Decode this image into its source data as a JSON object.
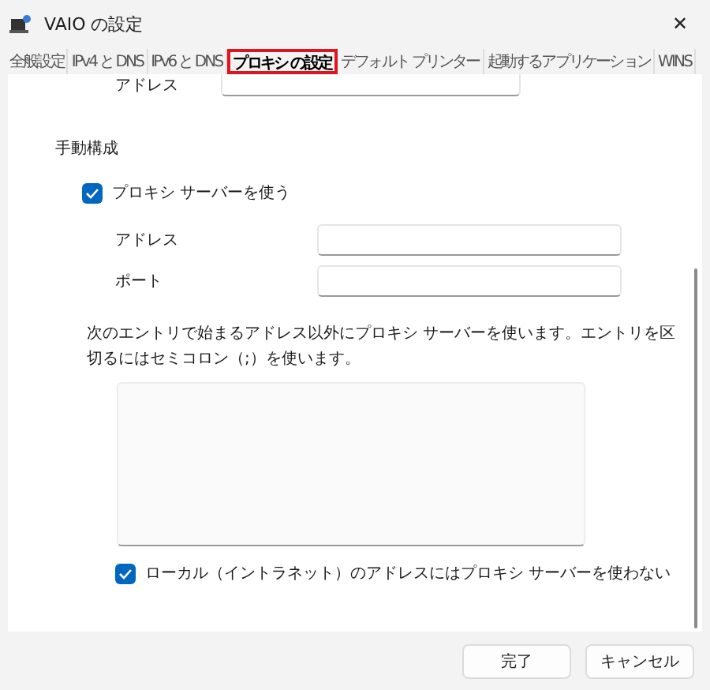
{
  "window": {
    "title": "VAIO の設定",
    "close": "✕"
  },
  "tabs": [
    {
      "label": "全般設定",
      "selected": false
    },
    {
      "label": "IPv4 と DNS",
      "selected": false
    },
    {
      "label": "IPv6 と DNS",
      "selected": false
    },
    {
      "label": "プロキシ の設定",
      "selected": true
    },
    {
      "label": "デフォルト プリンター",
      "selected": false
    },
    {
      "label": "起動するアプリケーション",
      "selected": false
    },
    {
      "label": "WINS",
      "selected": false
    }
  ],
  "auto_address": {
    "label": "アドレス"
  },
  "manual": {
    "heading": "手動構成",
    "use_proxy": {
      "label": "プロキシ サーバーを使う",
      "checked": true
    },
    "fields": [
      {
        "label": "アドレス"
      },
      {
        "label": "ポート"
      }
    ],
    "exceptions_note": "次のエントリで始まるアドレス以外にプロキシ サーバーを使います。エントリを区切るにはセミコロン（;）を使います。",
    "bypass_local": {
      "label": "ローカル（イントラネット）のアドレスにはプロキシ サーバーを使わない",
      "checked": true
    }
  },
  "buttons": [
    "完了",
    "キャンセル"
  ]
}
